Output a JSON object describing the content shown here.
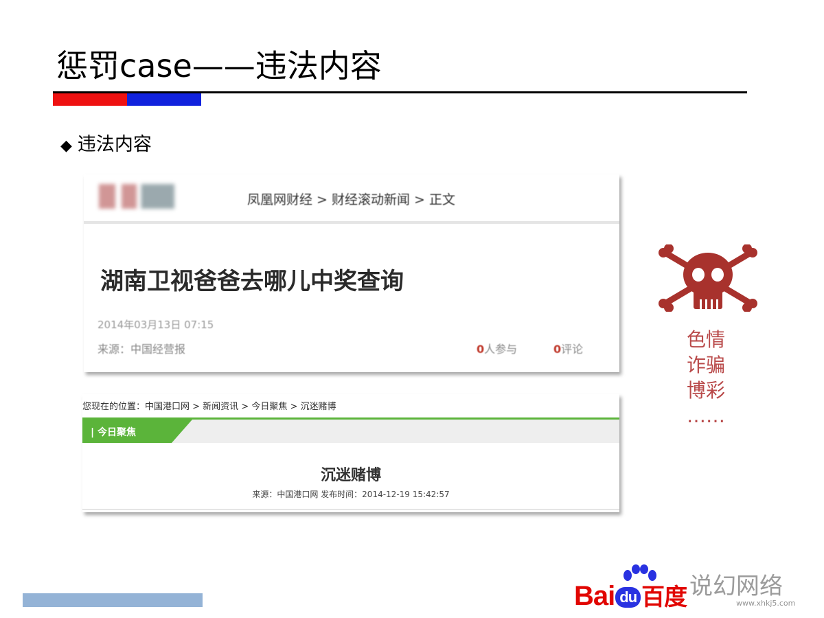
{
  "slide": {
    "title": "惩罚case——违法内容",
    "bullet_symbol": "◆",
    "bullet_text": "违法内容"
  },
  "card1": {
    "breadcrumb": "凤凰网财经 > 财经滚动新闻 > 正文",
    "headline": "湖南卫视爸爸去哪儿中奖查询",
    "date": "2014年03月13日 07:15",
    "source": "来源：中国经营报",
    "participants_count": "0",
    "participants_label": "人参与",
    "comments_count": "0",
    "comments_label": "评论"
  },
  "card2": {
    "breadcrumb": "您现在的位置：中国港口网 > 新闻资讯 > 今日聚焦 > 沉迷赌博",
    "tab_label": "| 今日聚焦",
    "headline": "沉迷赌博",
    "meta": "来源：中国港口网    发布时间：2014-12-19 15:42:57"
  },
  "sidebar": {
    "icon": "skull-crossbones-icon",
    "categories": [
      "色情",
      "诈骗",
      "博彩",
      "……"
    ]
  },
  "footer": {
    "logo_bai": "Bai",
    "logo_du": "du",
    "logo_cn": "百度",
    "watermark": "说幻网络",
    "watermark_url": "www.xhkj5.com"
  },
  "colors": {
    "accent_red": "#ee1111",
    "accent_blue": "#1122dd",
    "category_text": "#b94a4a",
    "skull": "#a8322d",
    "baidu_red": "#e10602",
    "baidu_blue": "#2932e1",
    "footer_bar": "#94b3d6",
    "card2_green": "#5bb43a"
  }
}
